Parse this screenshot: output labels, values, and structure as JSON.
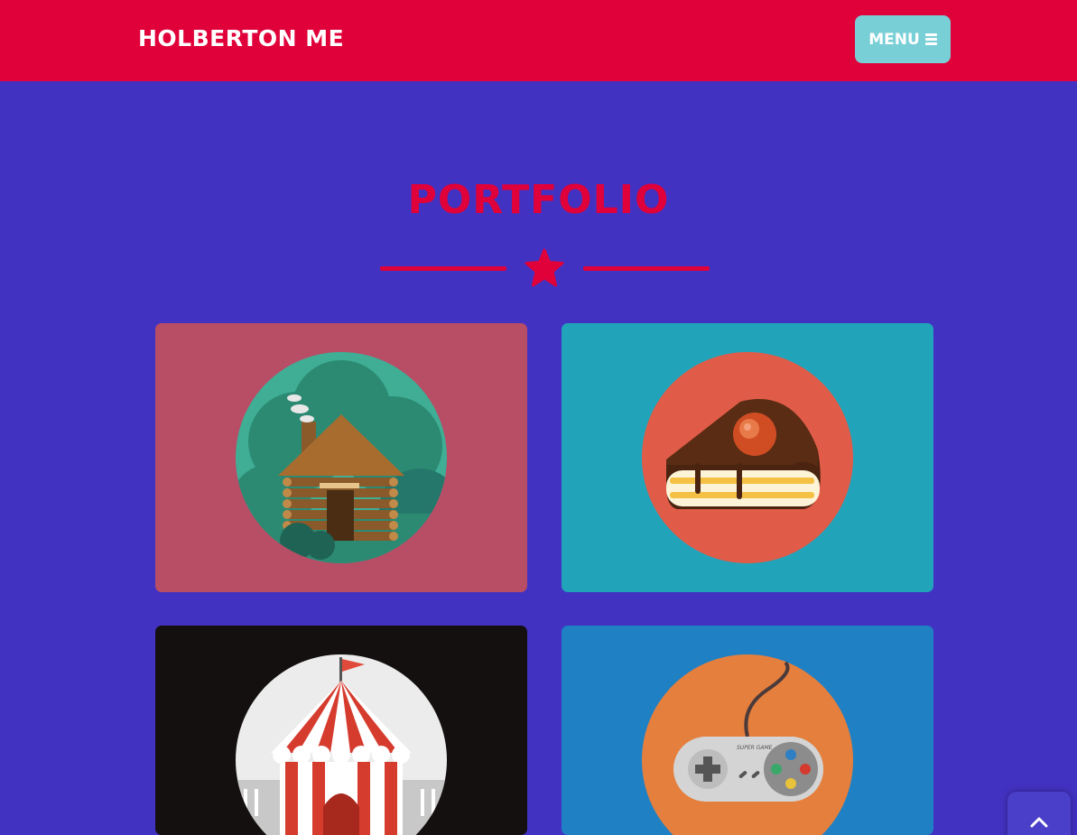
{
  "header": {
    "brand": "HOLBERTON ME",
    "menu_label": "MENU",
    "menu_icon": "hamburger-icon"
  },
  "portfolio": {
    "title": "PORTFOLIO",
    "divider_icon": "star-icon",
    "items": [
      {
        "icon": "log-cabin-icon",
        "bg": "#b84d66"
      },
      {
        "icon": "cake-slice-icon",
        "bg": "#21a3ba"
      },
      {
        "icon": "circus-tent-icon",
        "bg": "#141010"
      },
      {
        "icon": "game-controller-icon",
        "bg": "#1f80c4",
        "caption": "SUPER GAME"
      }
    ]
  },
  "scroll_top": {
    "icon": "chevron-up-icon"
  },
  "colors": {
    "primary": "#e0013a",
    "background": "#4232c2",
    "menu_button": "#79cfd6"
  }
}
